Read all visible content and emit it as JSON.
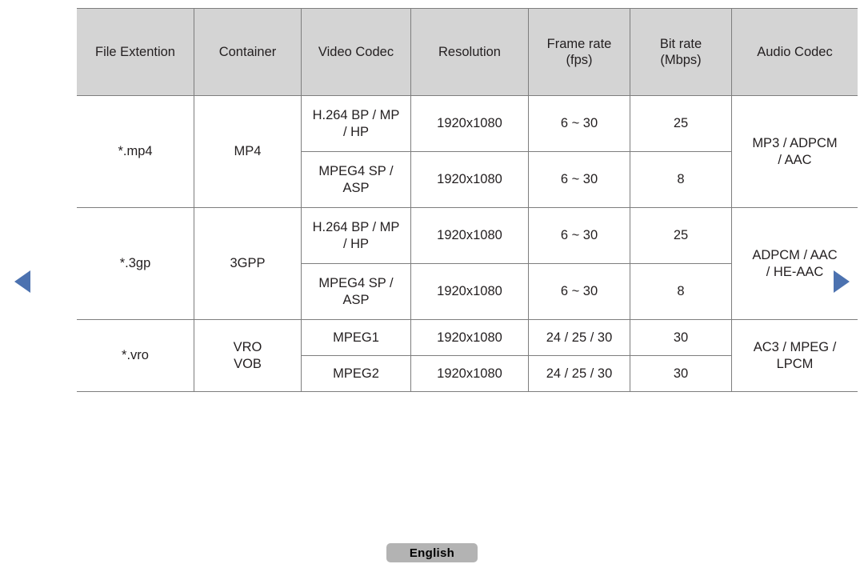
{
  "nav": {
    "prev_icon": "triangle-left-icon",
    "next_icon": "triangle-right-icon",
    "accent_color": "#4c72b0"
  },
  "table": {
    "header_bg": "#d4d4d4",
    "border_color": "#7d7d7d",
    "columns": [
      {
        "id": "file_extention",
        "line1": "File Extention",
        "line2": ""
      },
      {
        "id": "container",
        "line1": "Container",
        "line2": ""
      },
      {
        "id": "video_codec",
        "line1": "Video Codec",
        "line2": ""
      },
      {
        "id": "resolution",
        "line1": "Resolution",
        "line2": ""
      },
      {
        "id": "frame_rate",
        "line1": "Frame rate",
        "line2": "(fps)"
      },
      {
        "id": "bit_rate",
        "line1": "Bit rate",
        "line2": "(Mbps)"
      },
      {
        "id": "audio_codec",
        "line1": "Audio Codec",
        "line2": ""
      }
    ],
    "groups": [
      {
        "file_extention": "*.mp4",
        "container": "MP4",
        "container_line2": "",
        "audio_codec_line1": "MP3 / ADPCM",
        "audio_codec_line2": "/ AAC",
        "rows": [
          {
            "video_codec_line1": "H.264 BP / MP",
            "video_codec_line2": "/ HP",
            "resolution": "1920x1080",
            "frame_rate": "6 ~ 30",
            "bit_rate": "25"
          },
          {
            "video_codec_line1": "MPEG4 SP /",
            "video_codec_line2": "ASP",
            "resolution": "1920x1080",
            "frame_rate": "6 ~ 30",
            "bit_rate": "8"
          }
        ]
      },
      {
        "file_extention": "*.3gp",
        "container": "3GPP",
        "container_line2": "",
        "audio_codec_line1": "ADPCM / AAC",
        "audio_codec_line2": "/ HE-AAC",
        "rows": [
          {
            "video_codec_line1": "H.264 BP / MP",
            "video_codec_line2": "/ HP",
            "resolution": "1920x1080",
            "frame_rate": "6 ~ 30",
            "bit_rate": "25"
          },
          {
            "video_codec_line1": "MPEG4 SP /",
            "video_codec_line2": "ASP",
            "resolution": "1920x1080",
            "frame_rate": "6 ~ 30",
            "bit_rate": "8"
          }
        ]
      },
      {
        "file_extention": "*.vro",
        "container": "VRO",
        "container_line2": "VOB",
        "audio_codec_line1": "AC3 / MPEG /",
        "audio_codec_line2": "LPCM",
        "rows": [
          {
            "video_codec_line1": "MPEG1",
            "video_codec_line2": "",
            "resolution": "1920x1080",
            "frame_rate": "24 / 25 / 30",
            "bit_rate": "30"
          },
          {
            "video_codec_line1": "MPEG2",
            "video_codec_line2": "",
            "resolution": "1920x1080",
            "frame_rate": "24 / 25 / 30",
            "bit_rate": "30"
          }
        ]
      }
    ]
  },
  "footer": {
    "language_label": "English"
  }
}
